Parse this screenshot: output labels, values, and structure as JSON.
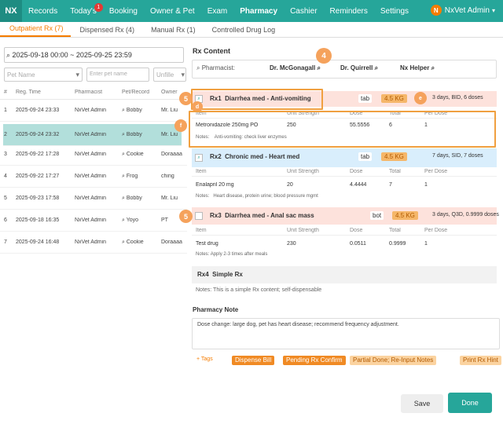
{
  "topnav": {
    "logo": "NX",
    "items": [
      "Records",
      "Today's",
      "Booking",
      "Owner & Pet",
      "Exam",
      "Pharmacy",
      "Cashier",
      "Reminders",
      "Settings"
    ],
    "active": "Pharmacy",
    "todays_badge": "1",
    "user_avatar": "N",
    "user_name": "NxVet Admin",
    "user_caret": "▾"
  },
  "subtabs": [
    "Outpatient Rx (7)",
    "Dispensed Rx (4)",
    "Manual Rx (1)",
    "Controlled Drug Log"
  ],
  "left": {
    "date_range": "⌕ 2025-09-18 00:00 ~ 2025-09-25 23:59",
    "pet_name_placeholder": "Pet Name",
    "pet_name_caret": "▾",
    "enter_pet_placeholder": "Enter pet name",
    "status_placeholder": "Unfille",
    "status_caret": "▾",
    "columns": [
      "#",
      "Reg. Time",
      "Pharmacist",
      "Pet/Record",
      "Owner"
    ],
    "rows": [
      {
        "num": "1",
        "time": "2025-09-24 23:33",
        "pharmacist": "NxVet Admin",
        "pet": "⌕ Bobby",
        "owner": "Mr. Liu"
      },
      {
        "num": "2",
        "time": "2025-09-24 23:32",
        "pharmacist": "NxVet Admin",
        "pet": "⌕ Bobby",
        "owner": "Mr. Liu"
      },
      {
        "num": "3",
        "time": "2025-09-22 17:28",
        "pharmacist": "NxVet Admin",
        "pet": "⌕ Cookie",
        "owner": "Doraaaa"
      },
      {
        "num": "4",
        "time": "2025-09-22 17:27",
        "pharmacist": "NxVet Admin",
        "pet": "⌕ Frog",
        "owner": "ching"
      },
      {
        "num": "5",
        "time": "2025-09-23 17:58",
        "pharmacist": "NxVet Admin",
        "pet": "⌕ Bobby",
        "owner": "Mr. Liu"
      },
      {
        "num": "6",
        "time": "2025-09-18 16:35",
        "pharmacist": "NxVet Admin",
        "pet": "⌕ Yoyo",
        "owner": "PT"
      },
      {
        "num": "7",
        "time": "2025-09-24 16:48",
        "pharmacist": "NxVet Admin",
        "pet": "⌕ Cookie",
        "owner": "Doraaaa"
      }
    ]
  },
  "rx": {
    "section_title": "Rx Content",
    "pharmacist_label": "⌕ Pharmacist:",
    "pharmacists": [
      "Dr. McGonagall ⌕",
      "Dr. Quirrell ⌕",
      "Nx Helper ⌕"
    ],
    "step_badges": {
      "pharmacist": "4",
      "rx1": "5",
      "rx3": "5",
      "rx1_qty": "e",
      "rx1_check": "d",
      "rx1_item": "f"
    },
    "table_columns": [
      "Item",
      "Unit Strength",
      "Dose",
      "Total",
      "Per Dose"
    ],
    "notes_label": "Notes:",
    "prescriptions": [
      {
        "label": "Rx1",
        "name": "Diarrhea med - Anti-vomiting",
        "form": "tab",
        "qty": "4.5 KG",
        "freq": "3 days, BID, 6 doses",
        "item": "Metronidazole 250mg PO",
        "strength": "250",
        "dose": "55.5556",
        "total": "6",
        "per_dose": "1",
        "notes": "Anti-vomiting: check liver enzymes"
      },
      {
        "label": "Rx2",
        "name": "Chronic med - Heart med",
        "form": "tab",
        "qty": "4.5 KG",
        "freq": "7 days, SID, 7 doses",
        "item": "Enalapril 20 mg",
        "strength": "20",
        "dose": "4.4444",
        "total": "7",
        "per_dose": "1",
        "notes": "Heart disease, protein urine; blood pressure mgmt"
      },
      {
        "label": "Rx3",
        "name": "Diarrhea med - Anal sac mass",
        "form": "bot",
        "qty": "4.5 KG",
        "freq": "3 days, Q3D, 0.9999 doses",
        "item": "Test drug",
        "strength": "230",
        "dose": "0.0511",
        "total": "0.9999",
        "per_dose": "1",
        "notes": "Apply 2-3 times after meals"
      },
      {
        "label": "Rx4",
        "name": "Simple Rx",
        "notes_full": "Notes: This is a simple Rx content; self-dispensable"
      }
    ]
  },
  "pharmacy_note": {
    "title": "Pharmacy Note",
    "text": "Dose change: large dog, pet has heart disease; recommend frequency adjustment."
  },
  "tags": {
    "add_tag": "+ Tags",
    "buttons": [
      "Dispense Bill",
      "Pending Rx Confirm",
      "Partial Done; Re-Input Notes",
      "Print Rx Hint"
    ]
  },
  "actions": {
    "save": "Save",
    "done": "Done"
  },
  "colors": {
    "brand": "#26a69a",
    "accent": "#f57c00",
    "rx_orange_bg": "#fde2dc",
    "rx_blue_bg": "#d9eefc"
  }
}
